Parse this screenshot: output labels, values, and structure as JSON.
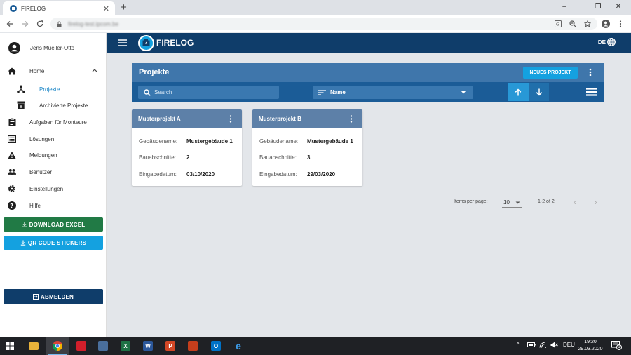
{
  "browser": {
    "tab_title": "FIRELOG",
    "url": "firelog-test.ipcom.be",
    "new_tab_symbol": "+",
    "tab_close_symbol": "✕",
    "window_controls": [
      "–",
      "❐",
      "✕"
    ]
  },
  "user": {
    "name": "Jens Mueller-Otto"
  },
  "sidebar": {
    "items": [
      {
        "label": "Home",
        "icon": "home-icon"
      },
      {
        "label": "Projekte",
        "icon": "project-tree-icon",
        "active": true
      },
      {
        "label": "Archivierte Projekte",
        "icon": "archive-icon"
      },
      {
        "label": "Aufgaben für Monteure",
        "icon": "clipboard-icon"
      },
      {
        "label": "Lösungen",
        "icon": "list-icon"
      },
      {
        "label": "Meldungen",
        "icon": "warning-icon"
      },
      {
        "label": "Benutzer",
        "icon": "people-icon"
      },
      {
        "label": "Einstellungen",
        "icon": "gear-icon"
      },
      {
        "label": "Hilfe",
        "icon": "help-icon"
      }
    ],
    "download_excel": "DOWNLOAD EXCEL",
    "qr_stickers": "QR CODE STICKERS",
    "logout": "ABMELDEN"
  },
  "appbar": {
    "brand": "FIRELOG",
    "language": "DE"
  },
  "projects": {
    "title": "Projekte",
    "new_button": "NEUES PROJEKT",
    "search_placeholder": "Search",
    "sort_label": "Name",
    "cards": [
      {
        "title": "Musterprojekt A",
        "fields": [
          {
            "key": "Gebäudename:",
            "value": "Mustergebäude 1"
          },
          {
            "key": "Bauabschnitte:",
            "value": "2"
          },
          {
            "key": "Eingabedatum:",
            "value": "03/10/2020"
          }
        ]
      },
      {
        "title": "Musterprojekt B",
        "fields": [
          {
            "key": "Gebäudename:",
            "value": "Mustergebäude 1"
          },
          {
            "key": "Bauabschnitte:",
            "value": "3"
          },
          {
            "key": "Eingabedatum:",
            "value": "29/03/2020"
          }
        ]
      }
    ],
    "paginator": {
      "items_per_page_label": "Items per page:",
      "page_size": "10",
      "range": "1-2 of 2",
      "prev_symbol": "‹",
      "next_symbol": "›"
    }
  },
  "taskbar": {
    "apps": [
      {
        "name": "file-explorer",
        "letter": "",
        "color": "#e8b23a"
      },
      {
        "name": "chrome",
        "letter": "",
        "color": "#4285f4",
        "active": true
      },
      {
        "name": "app-red",
        "letter": "",
        "color": "#d11f2b"
      },
      {
        "name": "network-app",
        "letter": "",
        "color": "#4a6f9c"
      },
      {
        "name": "excel",
        "letter": "X",
        "color": "#1e7145"
      },
      {
        "name": "word",
        "letter": "W",
        "color": "#2b579a"
      },
      {
        "name": "powerpoint",
        "letter": "P",
        "color": "#d24726"
      },
      {
        "name": "app-office",
        "letter": "",
        "color": "#c43e1c"
      },
      {
        "name": "outlook",
        "letter": "O",
        "color": "#0072c6"
      },
      {
        "name": "edge",
        "letter": "e",
        "color": "#0078d7"
      }
    ],
    "lang": "DEU",
    "time": "19:20",
    "date": "29.03.2020",
    "tray_arrow": "^",
    "notifications": "1"
  }
}
